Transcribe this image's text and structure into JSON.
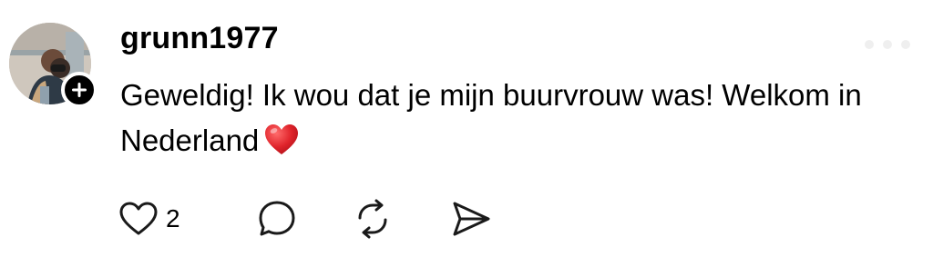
{
  "comment": {
    "username": "grunn1977",
    "text": "Geweldig! Ik wou dat je mijn buurvrouw was! Welkom in Nederland",
    "emoji_icon": "red-heart-emoji",
    "avatar_icon": "user-photo-avatar",
    "follow_icon": "plus-icon"
  },
  "actions": {
    "like_icon": "heart-outline-icon",
    "like_count": "2",
    "reply_icon": "speech-bubble-icon",
    "repost_icon": "repost-icon",
    "share_icon": "send-icon"
  },
  "colors": {
    "text": "#000000",
    "background": "#ffffff",
    "emoji_red": "#e0242b"
  }
}
